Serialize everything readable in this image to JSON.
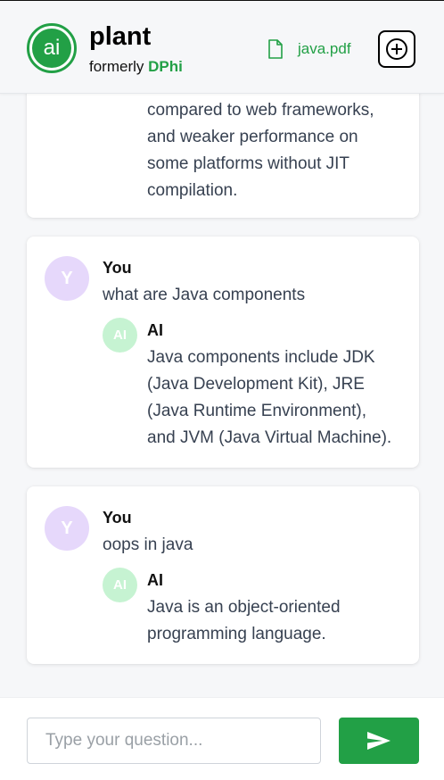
{
  "header": {
    "logo_text": "ai",
    "brand_title": "plant",
    "brand_sub_prefix": "formerly",
    "brand_sub_accent": "DPhi",
    "file_name": "java.pdf",
    "file_icon": "file-icon",
    "new_chat_icon": "plus-circle-icon"
  },
  "messages": [
    {
      "ai_lines": [
        "compared to web frameworks,",
        "and weaker performance on",
        "some platforms without JIT",
        "compilation."
      ]
    },
    {
      "user_avatar": "Y",
      "user_name": "You",
      "question": "what are Java components",
      "ai_avatar": "AI",
      "ai_name": "AI",
      "ai_lines": [
        "Java components include JDK",
        "(Java Development Kit), JRE",
        "(Java Runtime Environment),",
        "and JVM (Java Virtual Machine)."
      ]
    },
    {
      "user_avatar": "Y",
      "user_name": "You",
      "question": "oops in java",
      "ai_avatar": "AI",
      "ai_name": "AI",
      "ai_lines": [
        "Java is an object-oriented",
        "programming language."
      ]
    }
  ],
  "input": {
    "placeholder": "Type your question...",
    "value": "",
    "send_icon": "send-icon"
  },
  "colors": {
    "accent": "#22a046",
    "user_avatar_bg": "#e6d8fb",
    "ai_avatar_bg": "#c6f3d2"
  }
}
